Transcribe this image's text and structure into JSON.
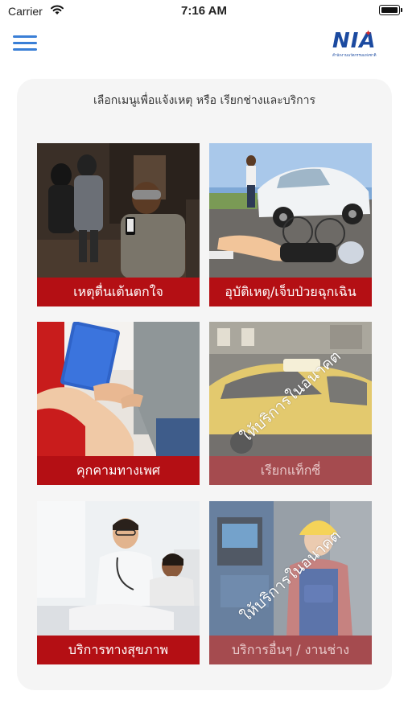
{
  "status_bar": {
    "carrier": "Carrier",
    "time": "7:16 AM"
  },
  "header": {
    "menu_icon": "hamburger-menu-icon",
    "logo_text": "NIA",
    "logo_subtitle": "สำนักงานนวัตกรรมแห่งชาติ"
  },
  "card": {
    "title": "เลือกเมนูเพื่อแจ้งเหตุ หรือ เรียกช่างและบริการ"
  },
  "tiles": [
    {
      "label": "เหตุตื่นเต้นตกใจ",
      "icon": "burglary-photo",
      "enabled": true
    },
    {
      "label": "อุบัติเหตุ/เจ็บป่วยฉุกเฉิน",
      "icon": "accident-photo",
      "enabled": true
    },
    {
      "label": "คุกคามทางเพศ",
      "icon": "harassment-photo",
      "enabled": true
    },
    {
      "label": "เรียกแท็กซี่",
      "icon": "taxi-photo",
      "enabled": false,
      "overlay": "ให้บริการในอนาคต"
    },
    {
      "label": "บริการทางสุขภาพ",
      "icon": "doctor-photo",
      "enabled": true
    },
    {
      "label": "บริการอื่นๆ / งานช่าง",
      "icon": "technician-photo",
      "enabled": false,
      "overlay": "ให้บริการในอนาคต"
    }
  ],
  "colors": {
    "label_red": "#b40f14",
    "label_disabled": "#a54b4f",
    "accent_blue": "#3a7fd6",
    "logo_blue": "#1b4aa0"
  }
}
